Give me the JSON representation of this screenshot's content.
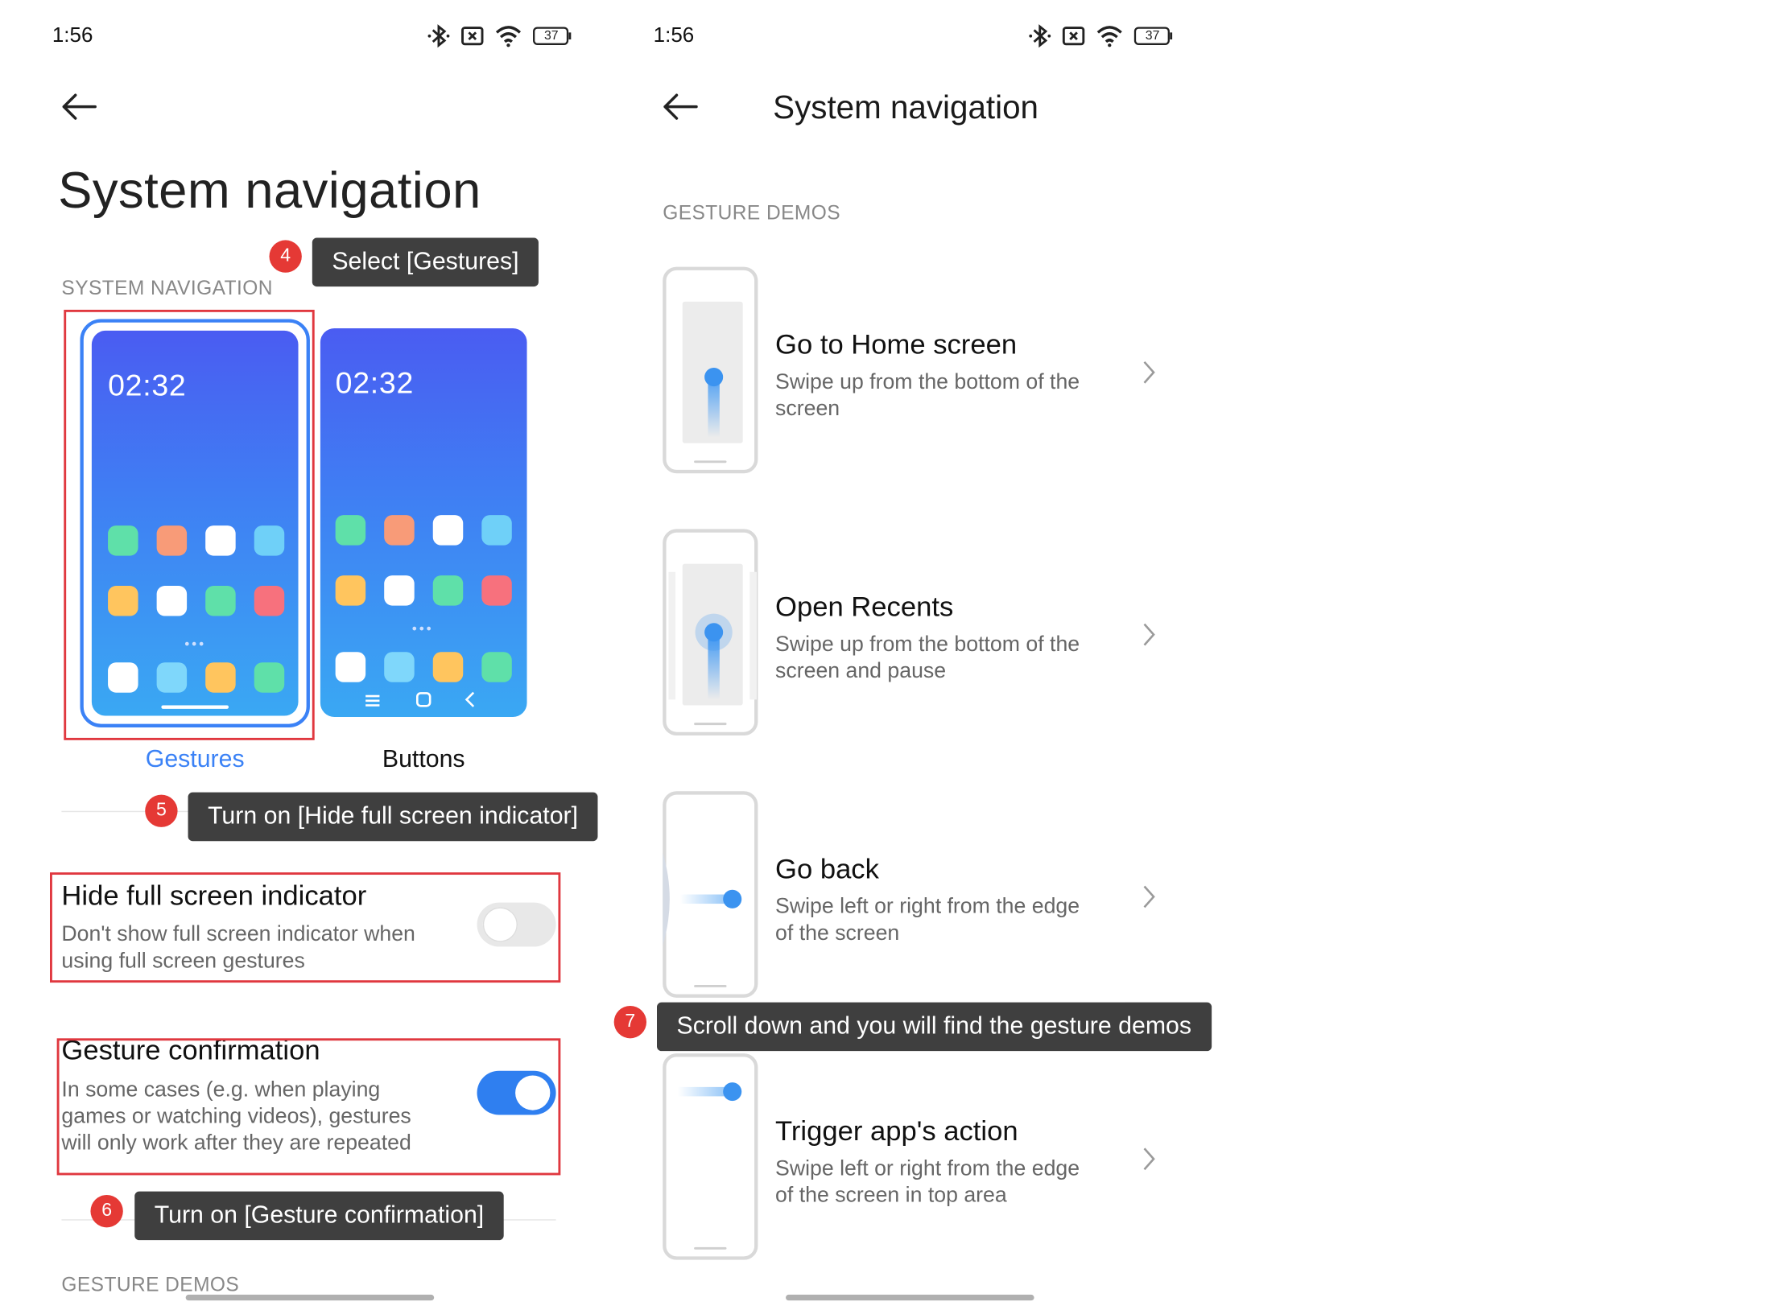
{
  "left_screen": {
    "status_time": "1:56",
    "battery": "37",
    "title": "System navigation",
    "section_label": "SYSTEM NAVIGATION",
    "options": [
      {
        "label": "Gestures",
        "clock": "02:32",
        "selected": true
      },
      {
        "label": "Buttons",
        "clock": "02:32",
        "selected": false
      }
    ],
    "settings": [
      {
        "title": "Hide full screen indicator",
        "desc1": "Don't show full screen indicator when",
        "desc2": "using full screen gestures",
        "enabled": false
      },
      {
        "title": "Gesture confirmation",
        "desc1": "In some cases (e.g. when playing",
        "desc2": "games or watching videos), gestures",
        "desc3": "will only work after they are repeated",
        "enabled": true
      }
    ],
    "bottom_section_label": "GESTURE DEMOS"
  },
  "right_screen": {
    "status_time": "1:56",
    "battery": "37",
    "title": "System navigation",
    "section_label": "GESTURE DEMOS",
    "demos": [
      {
        "title": "Go to Home screen",
        "desc1": "Swipe up from the bottom of the",
        "desc2": "screen"
      },
      {
        "title": "Open Recents",
        "desc1": "Swipe up from the bottom of the",
        "desc2": "screen and pause"
      },
      {
        "title": "Go back",
        "desc1": "Swipe left or right from the edge",
        "desc2": "of the screen"
      },
      {
        "title": "Trigger app's action",
        "desc1": "Swipe left or right from the edge",
        "desc2": "of the screen in top area"
      }
    ]
  },
  "annotations": [
    {
      "number": "4",
      "text": "Select [Gestures]"
    },
    {
      "number": "5",
      "text": "Turn on [Hide full screen indicator]"
    },
    {
      "number": "6",
      "text": "Turn on [Gesture confirmation]"
    },
    {
      "number": "7",
      "text": "Scroll down and you will find the gesture demos"
    }
  ],
  "colors": {
    "accent": "#3b82f6",
    "toggle_on": "#2f7ff0",
    "highlight_box": "#e0383f",
    "callout_bg": "#3f3f3f",
    "badge": "#e53935"
  },
  "icons": [
    "back-arrow-icon",
    "bluetooth-icon",
    "sim-off-icon",
    "wifi-icon",
    "battery-icon",
    "chevron-right-icon"
  ]
}
